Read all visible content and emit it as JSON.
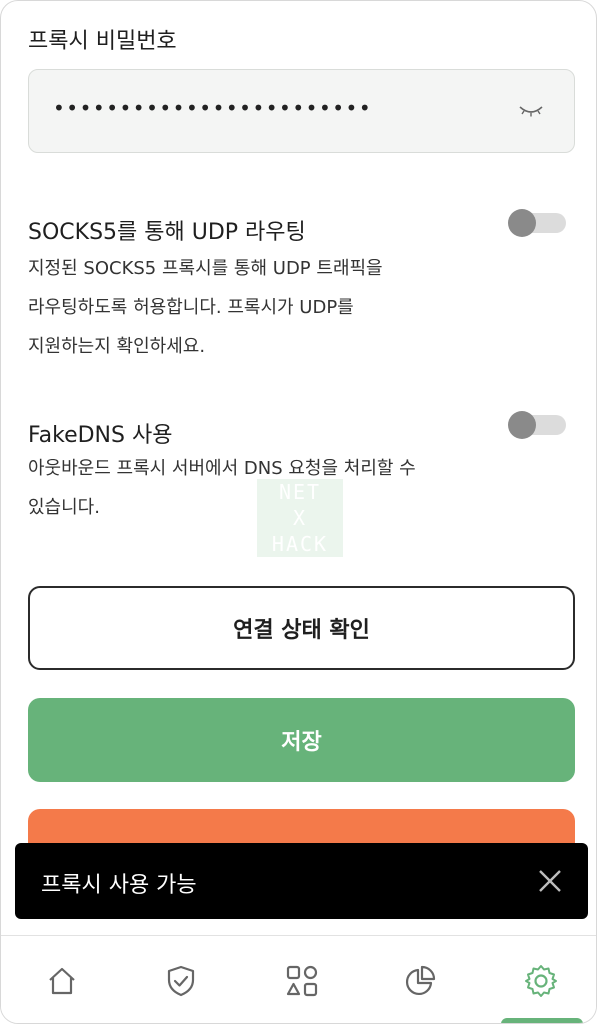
{
  "proxy_password": {
    "label": "프록시 비밀번호",
    "value": "••••••••••••••••••••••••",
    "toggle_icon": "eye-closed-icon"
  },
  "udp_routing": {
    "title": "SOCKS5를 통해 UDP 라우팅",
    "desc_lines": [
      "지정된 SOCKS5 프록시를 통해 UDP 트래픽을",
      "라우팅하도록 허용합니다. 프록시가 UDP를",
      "지원하는지 확인하세요."
    ],
    "enabled": false
  },
  "fakedns": {
    "title": "FakeDNS 사용",
    "desc_lines": [
      "아웃바운드 프록시 서버에서 DNS 요청을 처리할 수",
      "있습니다."
    ],
    "enabled": false
  },
  "watermark": {
    "lines": [
      "NET",
      "X",
      "HACK"
    ]
  },
  "buttons": {
    "check_status": "연결 상태 확인",
    "save": "저장"
  },
  "snackbar": {
    "message": "프록시 사용 가능",
    "close_icon": "close-icon"
  },
  "bottom_nav": {
    "items": [
      "home-icon",
      "shield-check-icon",
      "apps-grid-icon",
      "pie-chart-icon",
      "settings-gear-icon"
    ],
    "active": "settings-gear-icon"
  },
  "colors": {
    "accent_green": "#67b37a",
    "danger_orange": "#f47a4a",
    "snackbar_bg": "#000000"
  }
}
